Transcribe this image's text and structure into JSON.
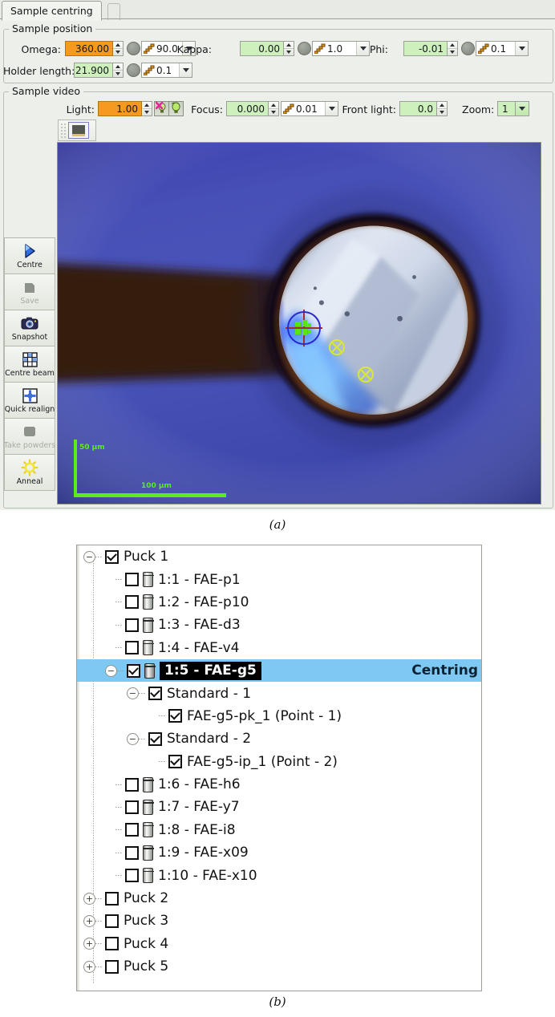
{
  "window": {
    "tab_label": "Sample centring"
  },
  "sample_position": {
    "legend": "Sample position",
    "fields": [
      {
        "label": "Omega:",
        "value": "360.00",
        "value_state": "orange",
        "step": "90.0"
      },
      {
        "label": "Kappa:",
        "value": "0.00",
        "value_state": "green",
        "step": "1.0"
      },
      {
        "label": "Phi:",
        "value": "-0.01",
        "value_state": "green",
        "step": "0.1"
      },
      {
        "label": "Holder length:",
        "value": "21.900",
        "value_state": "green",
        "step": "0.1"
      }
    ]
  },
  "sample_video": {
    "legend": "Sample video",
    "light_label": "Light:",
    "light_value": "1.00",
    "light_off_icon": "light-off-icon",
    "light_on_icon": "light-on-icon",
    "focus_label": "Focus:",
    "focus_value": "0.000",
    "focus_step": "0.01",
    "front_light_label": "Front light:",
    "front_light_value": "0.0",
    "zoom_label": "Zoom:",
    "zoom_value": "1",
    "video_toolbar_icon": "monitor-icon"
  },
  "actions": [
    {
      "name": "centre",
      "label": "Centre",
      "icon": "play-triangle-icon",
      "disabled": false
    },
    {
      "name": "save",
      "label": "Save",
      "icon": "save-icon",
      "disabled": true
    },
    {
      "name": "snapshot",
      "label": "Snapshot",
      "icon": "camera-icon",
      "disabled": false
    },
    {
      "name": "centre-beam",
      "label": "Centre beam",
      "icon": "grid-icon",
      "disabled": false
    },
    {
      "name": "quick-realign",
      "label": "Quick realign",
      "icon": "realign-icon",
      "disabled": false
    },
    {
      "name": "take-powders",
      "label": "Take powders",
      "icon": "powder-icon",
      "disabled": true
    },
    {
      "name": "anneal",
      "label": "Anneal",
      "icon": "sun-icon",
      "disabled": false
    }
  ],
  "video_overlay": {
    "scale_vertical_label": "50 µm",
    "scale_horizontal_label": "100 µm",
    "beam_marker": "beam-centre-crosshair",
    "points": [
      "centred-point-1",
      "centred-point-2"
    ]
  },
  "captions": {
    "a": "(a)",
    "b": "(b)"
  },
  "sample_tree": {
    "selected_badge": "Centring",
    "rows": [
      {
        "indent": 0,
        "expander": "minus",
        "checked": true,
        "vial": false,
        "label": "Puck 1"
      },
      {
        "indent": 1,
        "expander": "none",
        "checked": false,
        "vial": true,
        "label": "1:1 - FAE-p1"
      },
      {
        "indent": 1,
        "expander": "none",
        "checked": false,
        "vial": true,
        "label": "1:2 - FAE-p10"
      },
      {
        "indent": 1,
        "expander": "none",
        "checked": false,
        "vial": true,
        "label": "1:3 - FAE-d3"
      },
      {
        "indent": 1,
        "expander": "none",
        "checked": false,
        "vial": true,
        "label": "1:4 - FAE-v4"
      },
      {
        "indent": 1,
        "expander": "minus",
        "checked": true,
        "vial": true,
        "label": "1:5 - FAE-g5",
        "selected": true
      },
      {
        "indent": 2,
        "expander": "minus",
        "checked": true,
        "vial": false,
        "label": "Standard - 1"
      },
      {
        "indent": 3,
        "expander": "none",
        "checked": true,
        "vial": false,
        "label": "FAE-g5-pk_1 (Point - 1)"
      },
      {
        "indent": 2,
        "expander": "minus",
        "checked": true,
        "vial": false,
        "label": "Standard - 2"
      },
      {
        "indent": 3,
        "expander": "none",
        "checked": true,
        "vial": false,
        "label": "FAE-g5-ip_1 (Point - 2)"
      },
      {
        "indent": 1,
        "expander": "none",
        "checked": false,
        "vial": true,
        "label": "1:6 - FAE-h6"
      },
      {
        "indent": 1,
        "expander": "none",
        "checked": false,
        "vial": true,
        "label": "1:7 - FAE-y7"
      },
      {
        "indent": 1,
        "expander": "none",
        "checked": false,
        "vial": true,
        "label": "1:8 - FAE-i8"
      },
      {
        "indent": 1,
        "expander": "none",
        "checked": false,
        "vial": true,
        "label": "1:9 - FAE-x09"
      },
      {
        "indent": 1,
        "expander": "none",
        "checked": false,
        "vial": true,
        "label": "1:10 - FAE-x10"
      },
      {
        "indent": 0,
        "expander": "plus",
        "checked": false,
        "vial": false,
        "label": "Puck 2"
      },
      {
        "indent": 0,
        "expander": "plus",
        "checked": false,
        "vial": false,
        "label": "Puck 3"
      },
      {
        "indent": 0,
        "expander": "plus",
        "checked": false,
        "vial": false,
        "label": "Puck 4"
      },
      {
        "indent": 0,
        "expander": "plus",
        "checked": false,
        "vial": false,
        "label": "Puck 5"
      }
    ]
  },
  "colors": {
    "accent_orange": "#f59a1e",
    "field_green": "#cdf0bd",
    "selection_blue": "#7ec9f4",
    "overlay_green": "#5bec1a",
    "beam_ring_blue": "#2a2ad0",
    "point_yellow": "#d8e832"
  }
}
